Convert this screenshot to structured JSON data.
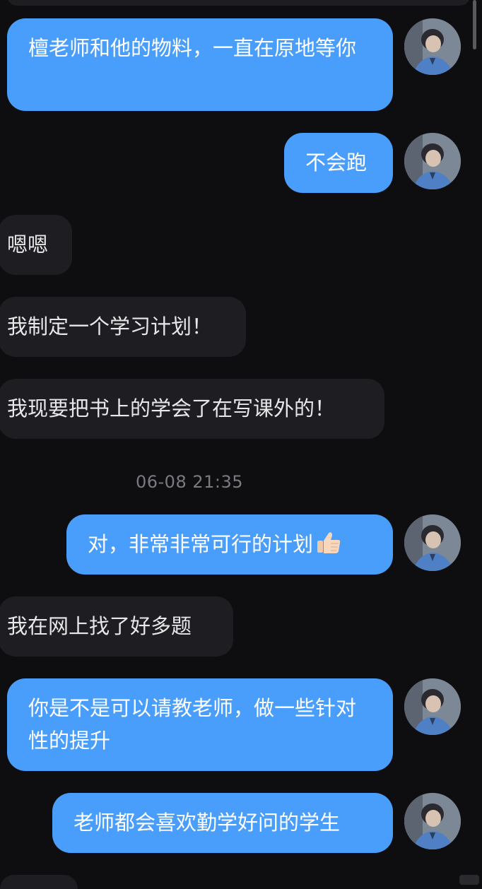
{
  "messages": [
    {
      "side": "out",
      "text": "檀老师和他的物料，一直在原地等你"
    },
    {
      "side": "out",
      "text": "不会跑"
    },
    {
      "side": "in",
      "text": "嗯嗯"
    },
    {
      "side": "in",
      "text": "我制定一个学习计划！"
    },
    {
      "side": "in",
      "text": "我现要把书上的学会了在写课外的！"
    },
    {
      "side": "out",
      "text": "对，非常非常可行的计划",
      "emoji": "thumbs-up"
    },
    {
      "side": "in",
      "text": "我在网上找了好多题"
    },
    {
      "side": "out",
      "text": "你是不是可以请教老师，做一些针对性的提升"
    },
    {
      "side": "out",
      "text": "老师都会喜欢勤学好问的学生"
    }
  ],
  "timestamp": "06-08 21:35",
  "colors": {
    "background": "#0e0e11",
    "outgoing_bubble": "#4a9efb",
    "incoming_bubble": "#1e1e22",
    "timestamp_text": "#7a7a80"
  }
}
